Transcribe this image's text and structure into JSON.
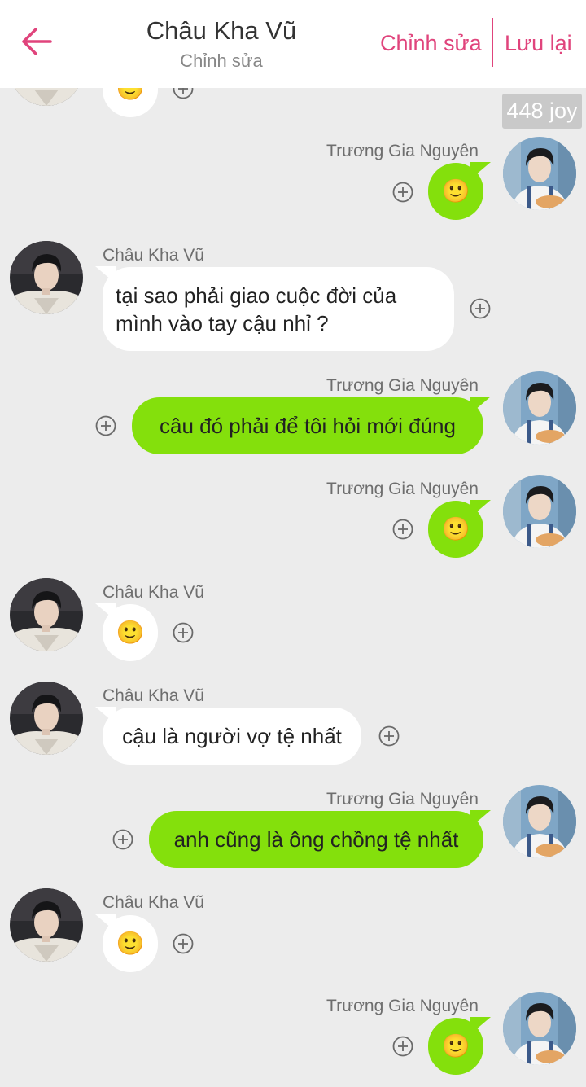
{
  "header": {
    "title": "Châu Kha Vũ",
    "subtitle": "Chỉnh sửa",
    "edit_label": "Chỉnh sửa",
    "save_label": "Lưu lại"
  },
  "badge": {
    "text": "448 joy"
  },
  "colors": {
    "accent": "#e0447c",
    "bubble_green": "#84e00c",
    "bubble_white": "#ffffff",
    "background": "#ececec"
  },
  "icons": {
    "back": "arrow-left-icon",
    "add": "plus-circle-icon",
    "emoji": "slightly-smiling-face"
  },
  "emoji_glyph": "🙂",
  "messages": [
    {
      "sender": "Châu Kha Vũ",
      "side": "left",
      "type": "emoji"
    },
    {
      "sender": "Trương Gia Nguyên",
      "side": "right",
      "type": "emoji"
    },
    {
      "sender": "Châu Kha Vũ",
      "side": "left",
      "type": "text",
      "text": "tại sao phải giao cuộc đời của mình vào tay cậu nhỉ ?"
    },
    {
      "sender": "Trương Gia Nguyên",
      "side": "right",
      "type": "text",
      "text": "câu đó phải để tôi hỏi mới đúng"
    },
    {
      "sender": "Trương Gia Nguyên",
      "side": "right",
      "type": "emoji"
    },
    {
      "sender": "Châu Kha Vũ",
      "side": "left",
      "type": "emoji"
    },
    {
      "sender": "Châu Kha Vũ",
      "side": "left",
      "type": "text",
      "text": "cậu là người vợ tệ nhất"
    },
    {
      "sender": "Trương Gia Nguyên",
      "side": "right",
      "type": "text",
      "text": "anh cũng là ông chồng tệ nhất"
    },
    {
      "sender": "Châu Kha Vũ",
      "side": "left",
      "type": "emoji"
    },
    {
      "sender": "Trương Gia Nguyên",
      "side": "right",
      "type": "emoji"
    }
  ]
}
